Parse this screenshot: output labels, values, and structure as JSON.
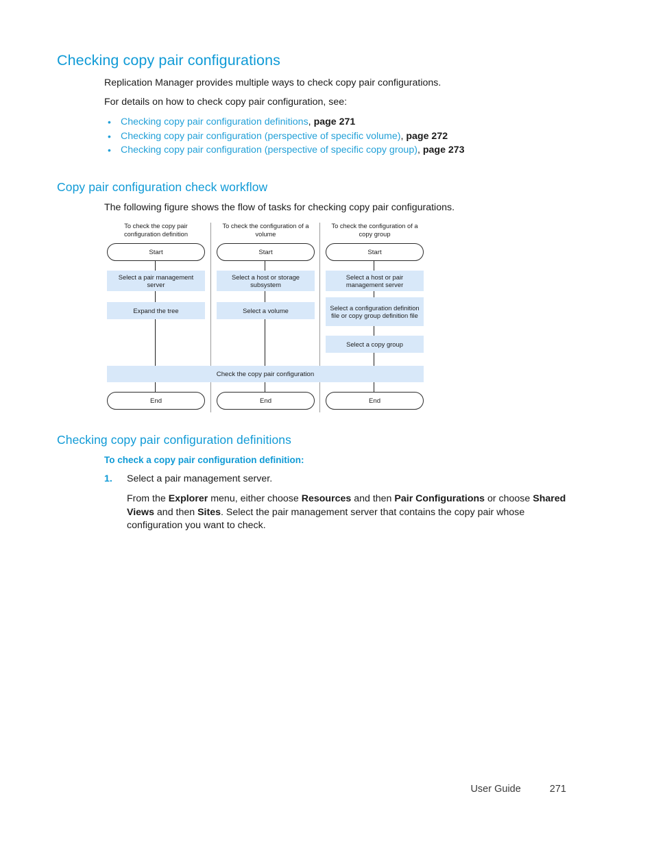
{
  "page": {
    "h1": "Checking copy pair configurations",
    "intro1": "Replication Manager provides multiple ways to check copy pair configurations.",
    "intro2": "For details on how to check copy pair configuration, see:",
    "links": [
      {
        "text": "Checking copy pair configuration definitions",
        "sep": ", ",
        "page": "page 271"
      },
      {
        "text": "Checking copy pair configuration (perspective of specific volume)",
        "sep": ", ",
        "page": "page 272"
      },
      {
        "text": "Checking copy pair configuration (perspective of specific copy group)",
        "sep": ", ",
        "page": "page 273"
      }
    ],
    "bullet_glyph": "•"
  },
  "workflow_section": {
    "heading": "Copy pair configuration check workflow",
    "intro": "The following figure shows the flow of tasks for checking copy pair configurations."
  },
  "diagram": {
    "columns": [
      {
        "header_line1": "To check the copy pair",
        "header_line2": "configuration definition",
        "start": "Start",
        "end": "End",
        "steps": [
          "Select a pair management server",
          "Expand the tree"
        ]
      },
      {
        "header_line1": "To check the configuration of a",
        "header_line2": "volume",
        "start": "Start",
        "end": "End",
        "steps": [
          "Select a host or storage subsystem",
          "Select a volume"
        ]
      },
      {
        "header_line1": "To check the configuration of a",
        "header_line2": "copy group",
        "start": "Start",
        "end": "End",
        "steps": [
          "Select a host or pair management server",
          "Select a configuration definition file or copy group definition file",
          "Select a copy group"
        ]
      }
    ],
    "shared_bar": "Check the copy pair configuration",
    "colors": {
      "process_fill": "#d8e8f9",
      "line": "#1d1d1d",
      "separator": "#9a9a9a"
    }
  },
  "definitions_section": {
    "heading": "Checking copy pair configuration definitions",
    "subheading": "To check a copy pair configuration definition:",
    "step_number": "1.",
    "step_title": "Select a pair management server.",
    "step_body": {
      "t1": "From the ",
      "b1": "Explorer",
      "t2": " menu, either choose ",
      "b2": "Resources",
      "t3": " and then ",
      "b3": "Pair Configurations",
      "t4": " or choose ",
      "b4": "Shared Views",
      "t5": " and then ",
      "b5": "Sites",
      "t6": ". Select the pair management server that contains the copy pair whose configuration you want to check."
    }
  },
  "footer": {
    "label": "User Guide",
    "page_number": "271"
  },
  "theme": {
    "heading_blue": "#0f9ad6",
    "link_blue": "#22a0d8",
    "body_text": "#1a1a1a"
  }
}
